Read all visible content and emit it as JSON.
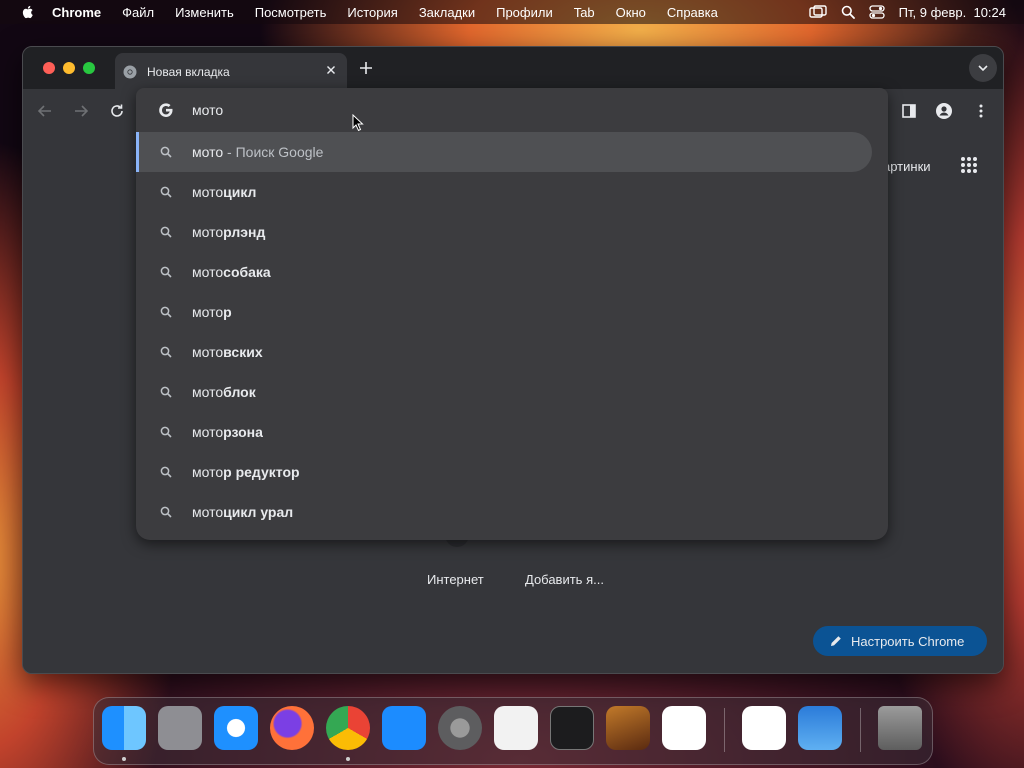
{
  "menubar": {
    "app_name": "Chrome",
    "items": [
      "Файл",
      "Изменить",
      "Посмотреть",
      "История",
      "Закладки",
      "Профили",
      "Tab",
      "Окно",
      "Справка"
    ],
    "datetime": "Пт, 9 февр.  10:24"
  },
  "tab": {
    "title": "Новая вкладка"
  },
  "omnibox": {
    "query": "мото",
    "suggestions": [
      {
        "typed": "мото",
        "rest": "",
        "desc": " - Поиск Google",
        "selected": true
      },
      {
        "typed": "мото",
        "rest": "цикл"
      },
      {
        "typed": "мото",
        "rest": "рлэнд"
      },
      {
        "typed": "мото",
        "rest": "собака"
      },
      {
        "typed": "мото",
        "rest": "р"
      },
      {
        "typed": "мото",
        "rest": "вских"
      },
      {
        "typed": "мото",
        "rest": "блок"
      },
      {
        "typed": "мото",
        "rest": "рзона"
      },
      {
        "typed": "мото",
        "rest": "р редуктор"
      },
      {
        "typed": "мото",
        "rest": "цикл урал"
      }
    ]
  },
  "newtab": {
    "images_link": "артинки",
    "shortcuts": [
      "Интернет",
      "Добавить я..."
    ],
    "customize_button": "Настроить Chrome"
  },
  "colors": {
    "accent_blue": "#8ab4f8",
    "customize_bg": "#0b5394",
    "window_bg": "#35363a",
    "dropdown_bg": "#3c3c3f"
  },
  "dock": {
    "apps": [
      "finder-icon",
      "launchpad-icon",
      "safari-icon",
      "firefox-icon",
      "chrome-icon",
      "app-store-icon",
      "system-settings-icon",
      "textedit-icon",
      "terminal-icon",
      "garageband-icon",
      "vscode-icon",
      "visual-studio-icon",
      "weather-icon",
      "trash-icon"
    ]
  }
}
